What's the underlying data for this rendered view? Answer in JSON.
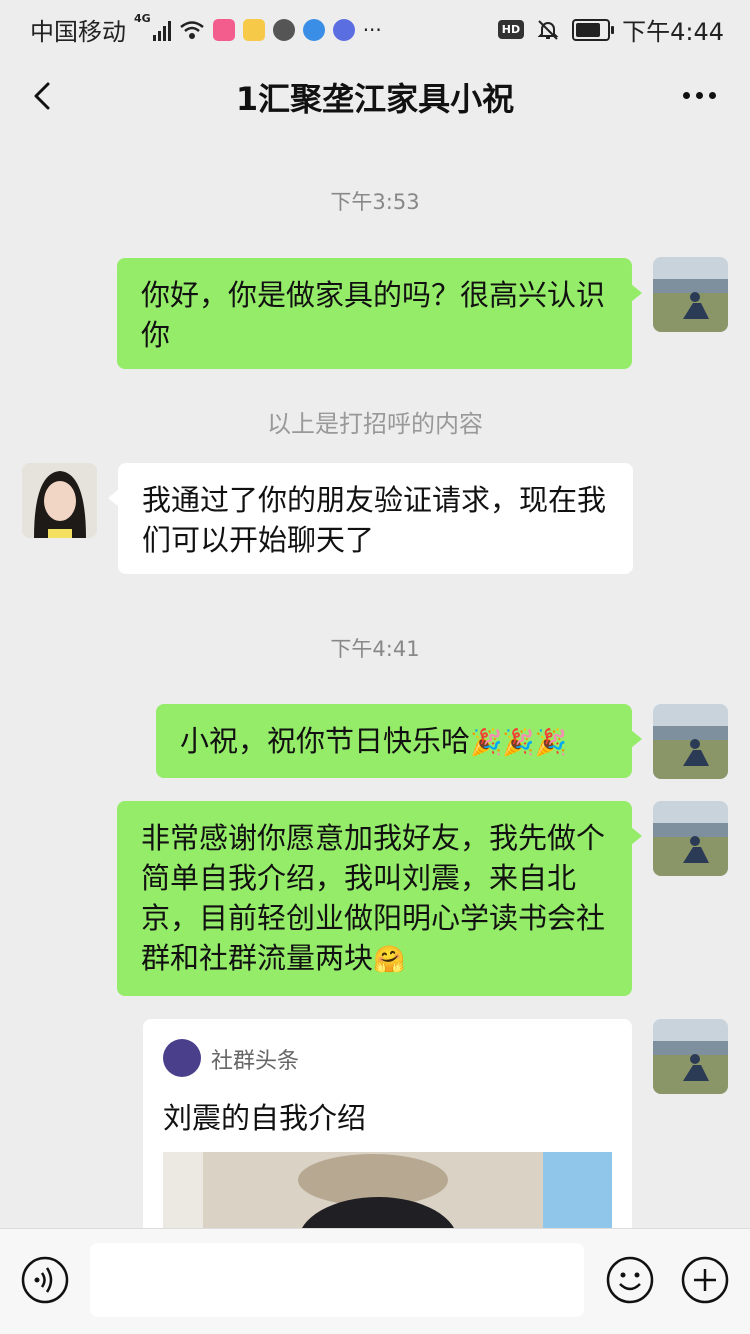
{
  "status_bar": {
    "carrier": "中国移动",
    "network": "4G",
    "hd_label": "HD",
    "time": "下午4:44"
  },
  "header": {
    "title": "1汇聚垄江家具小祝"
  },
  "messages": {
    "ts1": "下午3:53",
    "m1_text": "你好，你是做家具的吗？很高兴认识你",
    "system_note": "以上是打招呼的内容",
    "m2_text": "我通过了你的朋友验证请求，现在我们可以开始聊天了",
    "ts2": "下午4:41",
    "m3_text": "小祝，祝你节日快乐哈",
    "m3_emoji": "🎉🎉🎉",
    "m4_text": "非常感谢你愿意加我好友，我先做个简单自我介绍，我叫刘震，来自北京，目前轻创业做阳明心学读书会社群和社群流量两块",
    "m4_emoji": "🤗",
    "card_source": "社群头条",
    "card_title": "刘震的自我介绍"
  },
  "input": {
    "placeholder": ""
  },
  "icons": [
    "back-icon",
    "more-icon",
    "voice-icon",
    "emoji-icon",
    "plus-icon",
    "wifi-icon",
    "mute-icon",
    "battery-icon"
  ],
  "colors": {
    "background": "#ededed",
    "my_bubble": "#95ec69",
    "other_bubble": "#ffffff"
  }
}
